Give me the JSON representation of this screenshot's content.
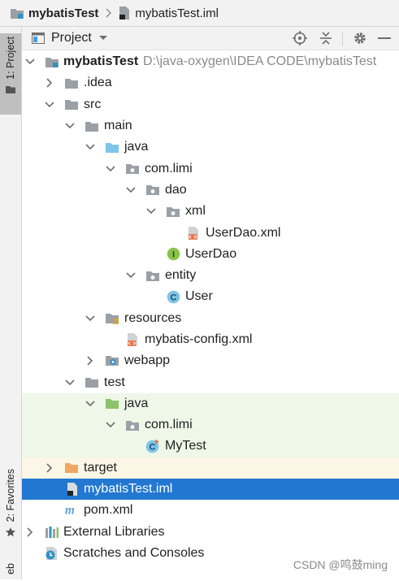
{
  "breadcrumb": {
    "project": "mybatisTest",
    "file": "mybatisTest.iml"
  },
  "sidebar": {
    "project_tab": "1: Project",
    "favorites_tab": "2: Favorites",
    "web_tab": "eb"
  },
  "panel": {
    "title": "Project",
    "icons": [
      "locate-icon",
      "collapse-all-icon",
      "settings-icon",
      "hide-icon"
    ]
  },
  "tree": [
    {
      "label": "mybatisTest",
      "hint": "D:\\java-oxygen\\IDEA CODE\\mybatisTest",
      "icon": "module-folder-icon",
      "expanded": true
    },
    {
      "label": ".idea",
      "icon": "folder-icon",
      "expanded": false
    },
    {
      "label": "src",
      "icon": "folder-icon",
      "expanded": true
    },
    {
      "label": "main",
      "icon": "folder-icon",
      "expanded": true
    },
    {
      "label": "java",
      "icon": "source-root-folder-icon",
      "expanded": true
    },
    {
      "label": "com.limi",
      "icon": "package-icon",
      "expanded": true
    },
    {
      "label": "dao",
      "icon": "package-icon",
      "expanded": true
    },
    {
      "label": "xml",
      "icon": "package-icon",
      "expanded": true
    },
    {
      "label": "UserDao.xml",
      "icon": "xml-file-icon"
    },
    {
      "label": "UserDao",
      "icon": "interface-icon"
    },
    {
      "label": "entity",
      "icon": "package-icon",
      "expanded": true
    },
    {
      "label": "User",
      "icon": "class-icon"
    },
    {
      "label": "resources",
      "icon": "resources-folder-icon",
      "expanded": true
    },
    {
      "label": "mybatis-config.xml",
      "icon": "xml-file-icon"
    },
    {
      "label": "webapp",
      "icon": "web-folder-icon",
      "expanded": false
    },
    {
      "label": "test",
      "icon": "folder-icon",
      "expanded": true
    },
    {
      "label": "java",
      "icon": "test-root-folder-icon",
      "expanded": true
    },
    {
      "label": "com.limi",
      "icon": "package-icon",
      "expanded": true
    },
    {
      "label": "MyTest",
      "icon": "test-class-icon"
    },
    {
      "label": "target",
      "icon": "excluded-folder-icon",
      "expanded": false
    },
    {
      "label": "mybatisTest.iml",
      "icon": "iml-file-icon"
    },
    {
      "label": "pom.xml",
      "icon": "maven-icon"
    },
    {
      "label": "External Libraries",
      "icon": "libraries-icon",
      "expanded": false
    },
    {
      "label": "Scratches and Consoles",
      "icon": "scratches-icon"
    }
  ],
  "colors": {
    "selection": "#2278d0",
    "test_background": "#eef7e8",
    "excluded_background": "#fbf6e5",
    "folder": "#9aa0a6",
    "source_root": "#7fc4e8",
    "test_root": "#8cc26b",
    "excluded": "#f0a764"
  },
  "watermark": "CSDN @鸣鼓ming"
}
